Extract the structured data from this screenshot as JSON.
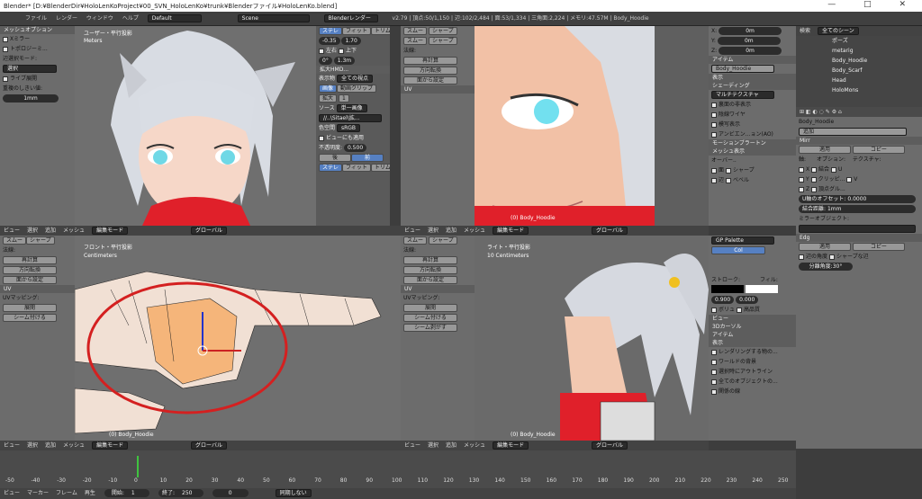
{
  "window": {
    "title": "Blender* [D:¥BlenderDir¥HoloLenKoProject¥00_SVN_HoloLenKo¥trunk¥Blenderファイル¥HoloLenKo.blend]",
    "controls": "— □ ✕"
  },
  "menubar": {
    "items": [
      "ファイル",
      "レンダー",
      "ウィンドウ",
      "ヘルプ"
    ],
    "layout": "Default",
    "scene": "Scene",
    "engine": "Blenderレンダー",
    "stats": "v2.79 | 頂点:50/1,150 | 辺:102/2,484 | 面:53/1,334 | 三角面:2,224 | メモリ:47.57M | Body_Hoodie"
  },
  "toolshelf": {
    "title": "メッシュオプション",
    "xmirror": "Xミラー",
    "topomirror": "トポロジーミ...",
    "selmode": "辺選択モード:",
    "select": "選択",
    "livecut": "ライブ展開",
    "dist_label": "重複のしきい値:",
    "dist": "1mm"
  },
  "vp_user": {
    "label": "ユーザー・平行投影",
    "unit": "Meters"
  },
  "vp_front": {
    "label": "フロント・平行投影",
    "unit": "Centimeters",
    "obj": "(0) Body_Hoodie"
  },
  "vp_cam": {
    "label": "",
    "obj": "(0) Body_Hoodie"
  },
  "vp_right": {
    "label": "ライト・平行投影",
    "unit": "10 Centimeters",
    "obj": "(0) Body_Hoodie"
  },
  "imgpanel": {
    "stereo": "ステレ",
    "fit": "フィット",
    "trim": "トリム",
    "v1": "-0.35",
    "v2": "1.70",
    "left": "左右",
    "updown": "上下",
    "v3": "0°",
    "v4": "1.3m",
    "title": "拡大HMD...",
    "display": "表示物",
    "all": "全ての視点",
    "image": "画像",
    "movieclip": "動画クリップ",
    "zoom": "拡大",
    "one": "1",
    "source": "ソース",
    "single": "単一画像",
    "file": "//..\\Sitael\\拡...",
    "colorspace": "色空間",
    "srgb": "sRGB",
    "viewapply": "ビューにも適用",
    "alpha_label": "不透明度:",
    "alpha": "0.500",
    "back": "後",
    "front": "前"
  },
  "uvpanel": {
    "smooth": "スムー",
    "sharp": "シャープ",
    "normal": "法線:",
    "recalc": "再計算",
    "flipdir": "方向転換",
    "set": "面から設定",
    "uv": "UV",
    "uvmapping": "UVマッピング:",
    "unwrap": "展開",
    "mark": "シーム付ける",
    "clear": "シーム剥がす"
  },
  "props_n": {
    "x": "X:",
    "y": "Y:",
    "z": "Z:",
    "xv": "0m",
    "yv": "0m",
    "zv": "0m",
    "item": "アイテム",
    "name": "Body_Hoodie",
    "display": "表示",
    "shading": "シェーディング",
    "multitex": "マルチテクスチャ",
    "backface": "裏面の非表示",
    "hidewire": "陰線ワイヤ",
    "texsolid": "模写表示",
    "ao": "アンビエン...ョン(AO)",
    "motion": "モーションブラートン",
    "meshdisp": "メッシュ表示",
    "overlay": "オーバー..",
    "face": "面",
    "sharp2": "シャープ",
    "edge": "辺",
    "bevel": "ベベル"
  },
  "gp": {
    "palette": "GP Palette",
    "col": "Col",
    "stroke": "ストローク:",
    "fill": "フィル:",
    "sv": "0.900",
    "fv": "0.000",
    "vol": "ボリュ",
    "hq": "高品質"
  },
  "props_r": {
    "view": "ビュー",
    "cursor3d": "3Dカーソル",
    "item": "アイテム",
    "display": "表示",
    "outline": "レンダリングする物の...",
    "world": "ワールドの背景",
    "selonly": "選択時にアウトライン",
    "allobj": "全てのオブジェクトの...",
    "rel": "関係の線"
  },
  "outliner": {
    "search": "検索",
    "scene": "全てのシーン",
    "items": [
      "ポーズ",
      "metarig",
      "Body_Hoodie",
      "Body_Scarf",
      "Head",
      "HoloMons"
    ]
  },
  "modifiers": {
    "obj": "Body_Hoodie",
    "add": "追加",
    "mirror": "Mirr",
    "apply": "適用",
    "copy": "コピー",
    "axis": "軸:",
    "options": "オプション:",
    "texture": "テクスチャ:",
    "x": "X",
    "y": "Y",
    "z": "Z",
    "merge": "結合",
    "clip": "クリッピ...",
    "vgroups": "頂点グル...",
    "u": "U",
    "v": "V",
    "uoffset": "U軸のオフセット:",
    "uoval": "0.0000",
    "mergedist": "結合距離:",
    "mdval": "1mm",
    "mirrorobj": "ミラーオブジェクト:",
    "edge": "Edg",
    "angle": "辺の角度",
    "sharp": "シャープな辺",
    "splitangle": "分離角度:",
    "saval": "30°"
  },
  "vpheader": {
    "view": "ビュー",
    "select": "選択",
    "add": "追加",
    "mesh": "メッシュ",
    "mode": "編集モード",
    "global": "グローバル"
  },
  "timeline": {
    "ticks": [
      "-50",
      "-40",
      "-30",
      "-20",
      "-10",
      "0",
      "10",
      "20",
      "30",
      "40",
      "50",
      "60",
      "70",
      "80",
      "90",
      "100",
      "110",
      "120",
      "130",
      "140",
      "150",
      "160",
      "170",
      "180",
      "190",
      "200",
      "210",
      "220",
      "230",
      "240",
      "250"
    ],
    "view": "ビュー",
    "marker": "マーカー",
    "frame": "フレーム",
    "play": "再生",
    "start_label": "開始:",
    "start": "1",
    "end_label": "終了:",
    "end": "250",
    "cur": "0",
    "sync": "同期しない"
  }
}
